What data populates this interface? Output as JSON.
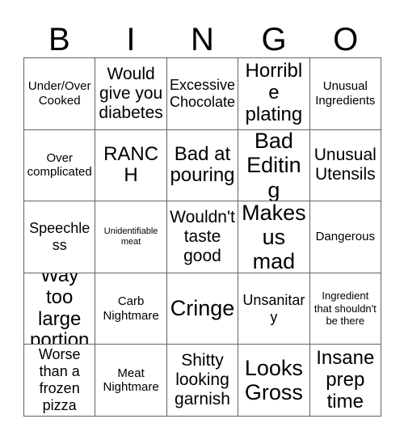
{
  "card": {
    "header_letters": [
      "B",
      "I",
      "N",
      "G",
      "O"
    ],
    "columns": 5,
    "rows": 5,
    "background_color": "#ffffff",
    "border_color": "#636363",
    "text_color": "#000000",
    "cells": [
      [
        {
          "text": "Under/Over Cooked",
          "size": "sm"
        },
        {
          "text": "Would give you diabetes",
          "size": "lg"
        },
        {
          "text": "Excessive Chocolate",
          "size": "md"
        },
        {
          "text": "Horrible plating",
          "size": "xl"
        },
        {
          "text": "Unusual Ingredients",
          "size": "sm"
        }
      ],
      [
        {
          "text": "Over complicated",
          "size": "sm"
        },
        {
          "text": "RANCH",
          "size": "xl"
        },
        {
          "text": "Bad at pouring",
          "size": "xl"
        },
        {
          "text": "Bad Editing",
          "size": "xxl"
        },
        {
          "text": "Unusual Utensils",
          "size": "lg"
        }
      ],
      [
        {
          "text": "Speechless",
          "size": "md"
        },
        {
          "text": "Unidentifiable meat",
          "size": "xxs"
        },
        {
          "text": "Wouldn't taste good",
          "size": "lg"
        },
        {
          "text": "Makes us mad",
          "size": "xxl"
        },
        {
          "text": "Dangerous",
          "size": "sm"
        }
      ],
      [
        {
          "text": "Way too large portion",
          "size": "xl"
        },
        {
          "text": "Carb Nightmare",
          "size": "sm"
        },
        {
          "text": "Cringe",
          "size": "xxl"
        },
        {
          "text": "Unsanitary",
          "size": "md"
        },
        {
          "text": "Ingredient that shouldn't be there",
          "size": "xs"
        }
      ],
      [
        {
          "text": "Worse than a frozen pizza",
          "size": "md"
        },
        {
          "text": "Meat Nightmare",
          "size": "sm"
        },
        {
          "text": "Shitty looking garnish",
          "size": "lg"
        },
        {
          "text": "Looks Gross",
          "size": "xxl"
        },
        {
          "text": "Insane prep time",
          "size": "xl"
        }
      ]
    ]
  }
}
